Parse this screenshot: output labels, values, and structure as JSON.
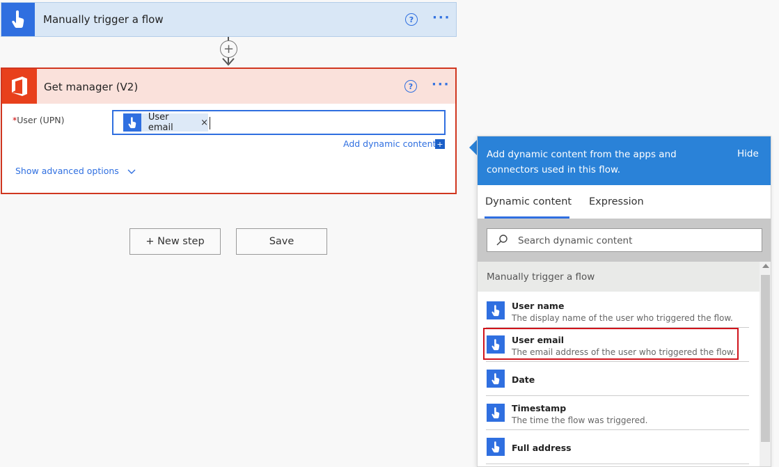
{
  "trigger": {
    "title": "Manually trigger a flow",
    "help_glyph": "?",
    "more_glyph": "···",
    "icon": "hand-touch-icon",
    "color": "#2f6fe0"
  },
  "connector": {
    "add_glyph": "+"
  },
  "manager": {
    "title": "Get manager (V2)",
    "help_glyph": "?",
    "more_glyph": "···",
    "icon": "office-icon",
    "color": "#e8401c",
    "field": {
      "required_mark": "*",
      "label": "User (UPN)",
      "token_label": "User email",
      "token_remove": "×"
    },
    "add_dynamic_label": "Add dynamic content",
    "add_dynamic_glyph": "+",
    "advanced_label": "Show advanced options"
  },
  "buttons": {
    "new_step": "+ New step",
    "save": "Save"
  },
  "panel": {
    "header_text": "Add dynamic content from the apps and connectors used in this flow.",
    "hide_label": "Hide",
    "color": "#2a82d8",
    "tabs": [
      "Dynamic content",
      "Expression"
    ],
    "active_tab": "Dynamic content",
    "search_placeholder": "Search dynamic content",
    "section_title": "Manually trigger a flow",
    "items": [
      {
        "name": "User name",
        "desc": "The display name of the user who triggered the flow."
      },
      {
        "name": "User email",
        "desc": "The email address of the user who triggered the flow."
      },
      {
        "name": "Date",
        "desc": ""
      },
      {
        "name": "Timestamp",
        "desc": "The time the flow was triggered."
      },
      {
        "name": "Full address",
        "desc": ""
      }
    ],
    "highlighted_item": "User email"
  }
}
